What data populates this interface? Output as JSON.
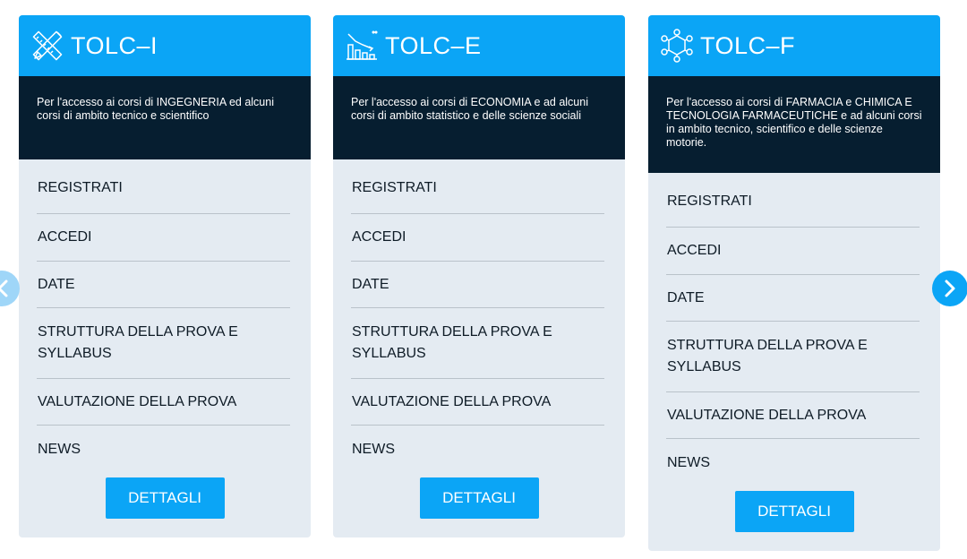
{
  "colors": {
    "accent": "#0ba5f6",
    "dark": "#061e30",
    "card_bg": "#e4ebf2"
  },
  "cards": [
    {
      "title": "TOLC–I",
      "icon": "pencil-ruler-icon",
      "description": "Per l'accesso ai corsi di INGEGNERIA ed alcuni corsi di ambito tecnico e scientifico",
      "links": [
        "REGISTRATI",
        "ACCEDI",
        "DATE",
        "STRUTTURA DELLA PROVA E SYLLABUS",
        "VALUTAZIONE DELLA PROVA",
        "NEWS"
      ],
      "button": "DETTAGLI"
    },
    {
      "title": "TOLC–E",
      "icon": "bar-chart-icon",
      "description": "Per l'accesso ai corsi di ECONOMIA e ad alcuni corsi di ambito statistico e delle scienze sociali",
      "links": [
        "REGISTRATI",
        "ACCEDI",
        "DATE",
        "STRUTTURA DELLA PROVA E SYLLABUS",
        "VALUTAZIONE DELLA PROVA",
        "NEWS"
      ],
      "button": "DETTAGLI"
    },
    {
      "title": "TOLC–F",
      "icon": "molecule-icon",
      "description": "Per l'accesso ai corsi di FARMACIA e CHIMICA E TECNOLOGIA FARMACEUTICHE e ad alcuni corsi in ambito tecnico, scientifico e delle scienze motorie.",
      "links": [
        "REGISTRATI",
        "ACCEDI",
        "DATE",
        "STRUTTURA DELLA PROVA E SYLLABUS",
        "VALUTAZIONE DELLA PROVA",
        "NEWS"
      ],
      "button": "DETTAGLI"
    }
  ],
  "carousel": {
    "prev_icon": "chevron-left-icon",
    "next_icon": "chevron-right-icon"
  }
}
